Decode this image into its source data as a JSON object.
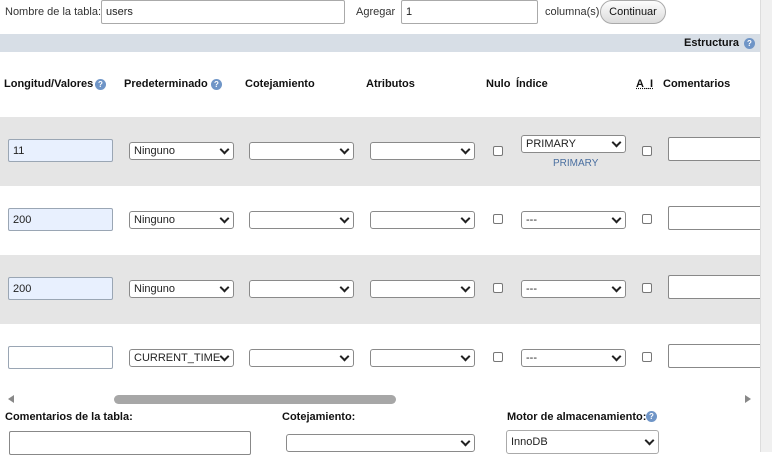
{
  "top": {
    "table_name_label": "Nombre de la tabla:",
    "table_name_value": "users",
    "add_label": "Agregar",
    "add_value": "1",
    "columns_label": "columna(s)",
    "continue_button": "Continuar"
  },
  "structure_bar": {
    "label": "Estructura"
  },
  "headers": {
    "length_values": "Longitud/Valores",
    "default": "Predeterminado",
    "collation": "Cotejamiento",
    "attributes": "Atributos",
    "null": "Nulo",
    "index": "Índice",
    "ai": "A_I",
    "comments": "Comentarios"
  },
  "rows": [
    {
      "length": "11",
      "default": "Ninguno",
      "collation": "",
      "attributes": "",
      "index": "PRIMARY",
      "index_note": "PRIMARY"
    },
    {
      "length": "200",
      "default": "Ninguno",
      "collation": "",
      "attributes": "",
      "index": "---"
    },
    {
      "length": "200",
      "default": "Ninguno",
      "collation": "",
      "attributes": "",
      "index": "---"
    },
    {
      "length": "",
      "default": "CURRENT_TIME",
      "collation": "",
      "attributes": "",
      "index": "---"
    }
  ],
  "bottom": {
    "table_comments_label": "Comentarios de la tabla:",
    "collation_label": "Cotejamiento:",
    "engine_label": "Motor de almacenamiento:",
    "engine_value": "InnoDB"
  },
  "colors": {
    "structure_bar": "#d7dee6",
    "row_shade": "#e5e5e5",
    "filled_input": "#e8f0fe",
    "help_icon": "#6f95c7"
  }
}
